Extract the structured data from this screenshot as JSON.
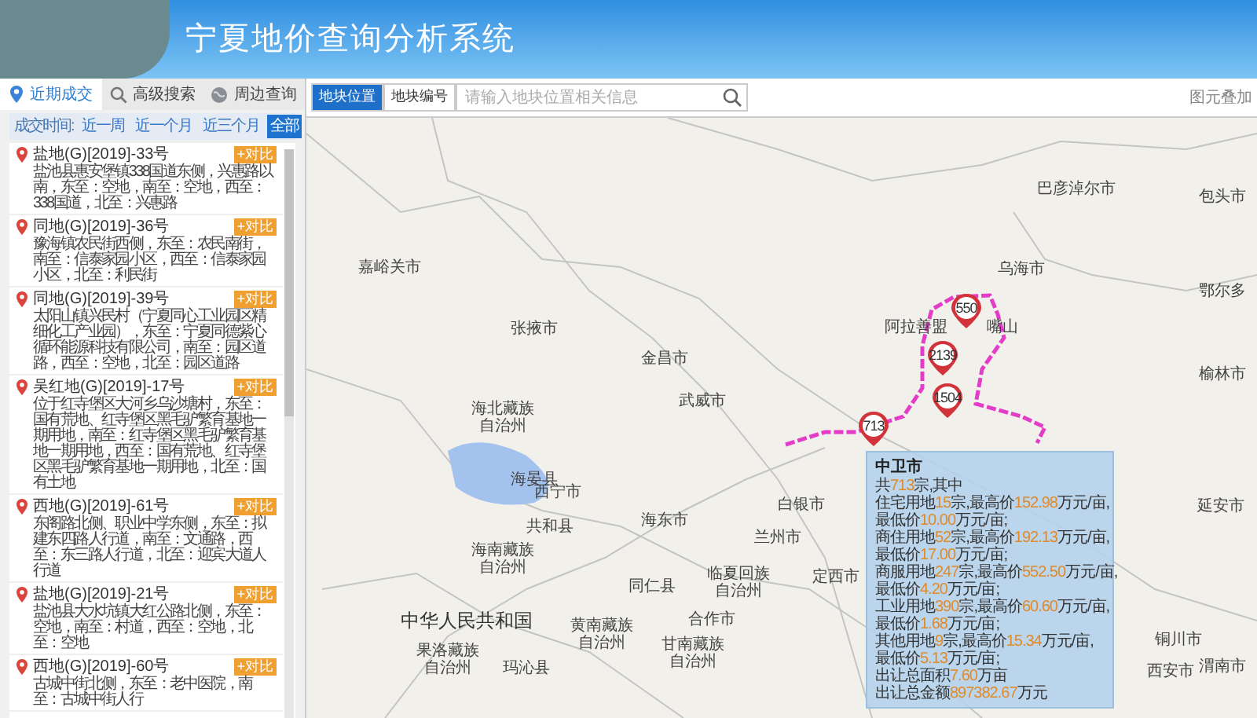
{
  "header": {
    "title": "宁夏地价查询分析系统"
  },
  "tabs": [
    {
      "label": "近期成交",
      "selected": true
    },
    {
      "label": "高级搜索",
      "selected": false
    },
    {
      "label": "周边查询",
      "selected": false
    }
  ],
  "filter": {
    "label": "成交时间:",
    "options": [
      {
        "label": "近一周",
        "selected": false
      },
      {
        "label": "近一个月",
        "selected": false
      },
      {
        "label": "近三个月",
        "selected": false
      },
      {
        "label": "全部",
        "selected": true
      }
    ]
  },
  "parcels": [
    {
      "title": "盐地(G)[2019]-33号",
      "description": "盐池县惠安堡镇338国道东侧，兴惠路以南，东至：空地，南至：空地，西至：338国道，北至：兴惠路",
      "button": "+对比"
    },
    {
      "title": "同地(G)[2019]-36号",
      "description": "豫海镇农民街西侧，东至：农民南街，南至：信泰家园小区，西至：信泰家园小区，北至：利民街",
      "button": "+对比"
    },
    {
      "title": "同地(G)[2019]-39号",
      "description": "太阳山镇兴民村（宁夏同心工业园区精细化工产业园），东至：宁夏同德紫心循环能源科技有限公司，南至：园区道路，西至：空地，北至：园区道路",
      "button": "+对比"
    },
    {
      "title": "吴红地(G)[2019]-17号",
      "description": "位于红寺堡区大河乡乌沙塘村，东至：国有荒地、红寺堡区黑毛驴繁育基地一期用地，南至：红寺堡区黑毛驴繁育基地一期用地，西至：国有荒地、红寺堡区黑毛驴繁育基地一期用地，北至：国有土地",
      "button": "+对比"
    },
    {
      "title": "西地(G)[2019]-61号",
      "description": "东阁路北侧、职业中学东侧，东至：拟建东四路人行道，南至：文通路，西至：东三路人行道，北至：迎宾大道人行道",
      "button": "+对比"
    },
    {
      "title": "盐地(G)[2019]-21号",
      "description": "盐池县大水坑镇大红公路北侧，东至：空地，南至：村道，西至：空地，北至：空地",
      "button": "+对比"
    },
    {
      "title": "西地(G)[2019]-60号",
      "description": "古城中街北侧，东至：老中医院，南至：古城中街人行",
      "button": "+对比"
    }
  ],
  "map_toolbar": {
    "modes": [
      {
        "label": "地块位置",
        "selected": true
      },
      {
        "label": "地块编号",
        "selected": false
      }
    ],
    "search": {
      "placeholder": "请输入地块位置相关信息"
    },
    "right_link": "图元叠加"
  },
  "map": {
    "labels": [
      "巴彦淖尔市",
      "包头市",
      "嘉峪关市",
      "乌海市",
      "鄂尔多",
      "张掖市",
      "阿拉善盟",
      "嘴山",
      "金昌市",
      "武威市",
      "榆林市",
      "海北藏族自治州",
      "海晏县",
      "西宁市",
      "白银市",
      "兰州市",
      "海东市",
      "共和县",
      "海南藏族自治州",
      "同仁县",
      "临夏回族自治州",
      "定西市",
      "延安市",
      "中华人民共和国",
      "黄南藏族自治州",
      "合作市",
      "果洛藏族自治州",
      "玛沁县",
      "甘南藏族自治州",
      "铜川市",
      "西安市",
      "渭南市"
    ],
    "markers": [
      "550",
      "2139",
      "1504",
      "713"
    ],
    "tooltip": {
      "title": "中卫市",
      "lines": [
        [
          {
            "text": "共"
          },
          {
            "text": "713",
            "highlight": true
          },
          {
            "text": "宗,其中"
          }
        ],
        [
          {
            "text": "住宅用地"
          },
          {
            "text": "15",
            "highlight": true
          },
          {
            "text": "宗,最高价"
          },
          {
            "text": "152.98",
            "highlight": true
          },
          {
            "text": "万元/亩,"
          }
        ],
        [
          {
            "text": "最低价"
          },
          {
            "text": "10.00",
            "highlight": true
          },
          {
            "text": "万元/亩;"
          }
        ],
        [
          {
            "text": "商住用地"
          },
          {
            "text": "52",
            "highlight": true
          },
          {
            "text": "宗,最高价"
          },
          {
            "text": "192.13",
            "highlight": true
          },
          {
            "text": "万元/亩,"
          }
        ],
        [
          {
            "text": "最低价"
          },
          {
            "text": "17.00",
            "highlight": true
          },
          {
            "text": "万元/亩;"
          }
        ],
        [
          {
            "text": "商服用地"
          },
          {
            "text": "247",
            "highlight": true
          },
          {
            "text": "宗,最高价"
          },
          {
            "text": "552.50",
            "highlight": true
          },
          {
            "text": "万元/亩,"
          }
        ],
        [
          {
            "text": "最低价"
          },
          {
            "text": "4.20",
            "highlight": true
          },
          {
            "text": "万元/亩;"
          }
        ],
        [
          {
            "text": "工业用地"
          },
          {
            "text": "390",
            "highlight": true
          },
          {
            "text": "宗,最高价"
          },
          {
            "text": "60.60",
            "highlight": true
          },
          {
            "text": "万元/亩,"
          }
        ],
        [
          {
            "text": "最低价"
          },
          {
            "text": "1.68",
            "highlight": true
          },
          {
            "text": "万元/亩;"
          }
        ],
        [
          {
            "text": "其他用地"
          },
          {
            "text": "9",
            "highlight": true
          },
          {
            "text": "宗,最高价"
          },
          {
            "text": "15.34",
            "highlight": true
          },
          {
            "text": "万元/亩,"
          }
        ],
        [
          {
            "text": "最低价"
          },
          {
            "text": "5.13",
            "highlight": true
          },
          {
            "text": "万元/亩;"
          }
        ],
        [
          {
            "text": "出让总面积"
          },
          {
            "text": "7.60",
            "highlight": true
          },
          {
            "text": "万亩"
          }
        ],
        [
          {
            "text": "出让总金额"
          },
          {
            "text": "897382.67",
            "highlight": true
          },
          {
            "text": "万元"
          }
        ]
      ]
    }
  }
}
